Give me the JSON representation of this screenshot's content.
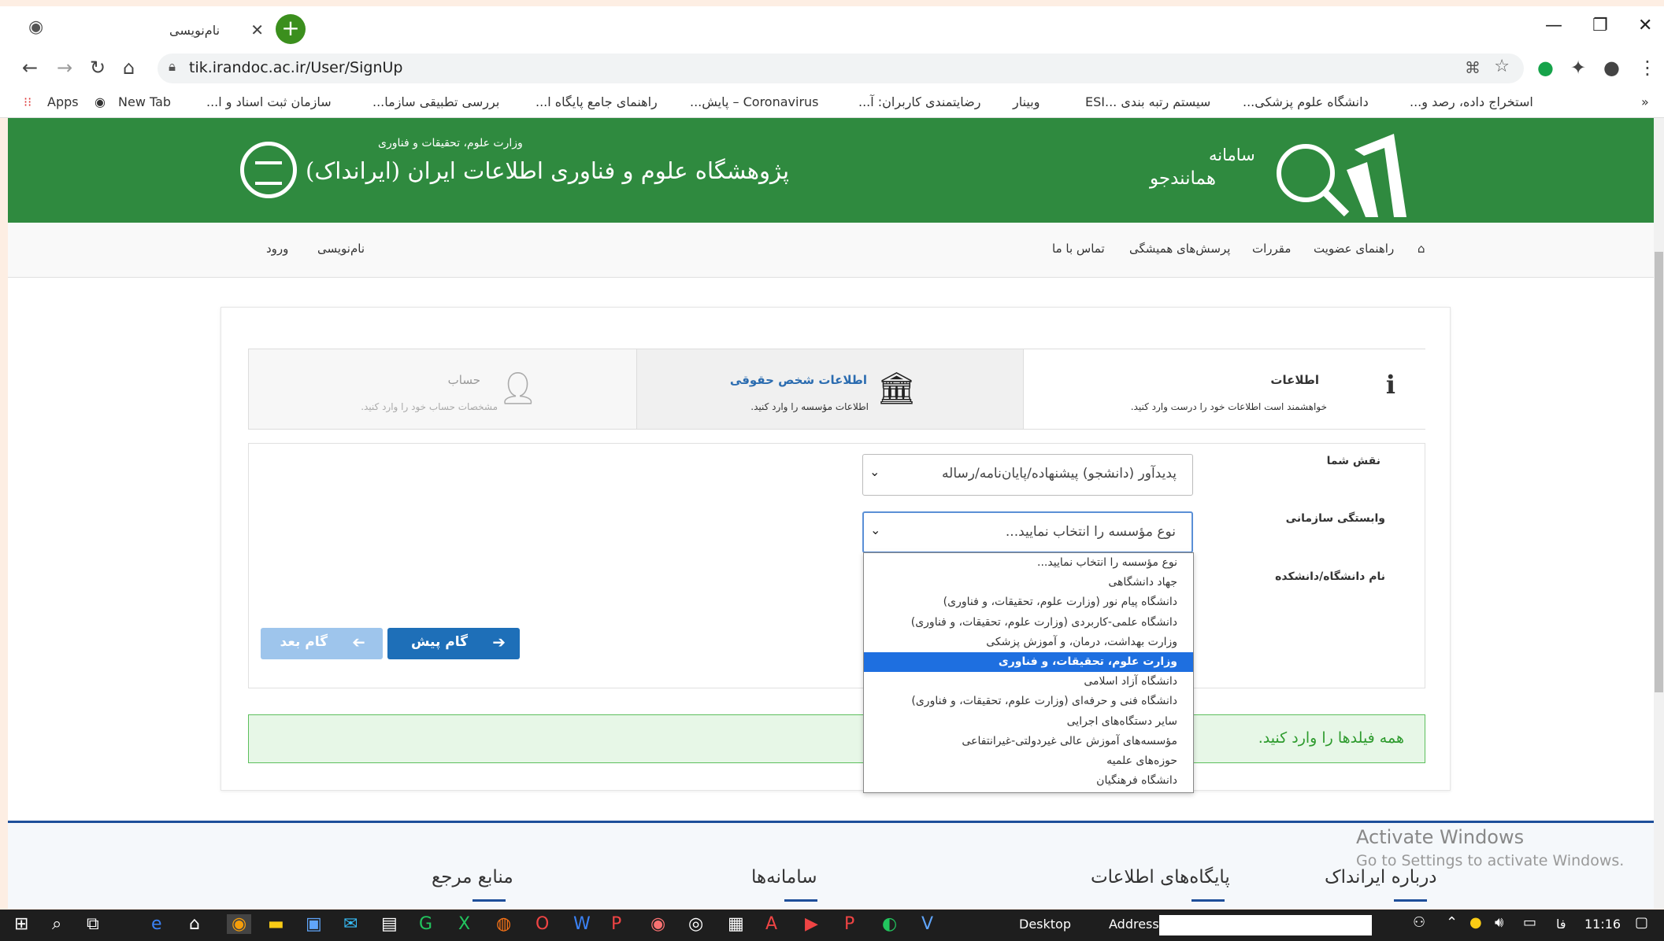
{
  "browser": {
    "tab_title": "نام‌نویسی",
    "url": "tik.irandoc.ac.ir/User/SignUp",
    "bookmarks": [
      "Apps",
      "New Tab",
      "سازمان ثبت اسناد و ا...",
      "بررسی تطبیقی سازما...",
      "راهنمای جامع پایگاه ا...",
      "Coronavirus – پایش...",
      "رضایتمندی کاربران: آ...",
      "وبینار",
      "سیستم رتبه بندی ...ESI",
      "دانشگاه علوم پزشکی...",
      "استخراج داده، رصد و..."
    ]
  },
  "header": {
    "ministry": "وزارت علوم، تحقیقات و فناوری",
    "institute": "پژوهشگاه علوم و فناوری اطلاعات ایران (ایرانداک)",
    "system_line1": "سامانه",
    "system_line2": "همانندجو"
  },
  "menu": {
    "home_icon": "home-icon",
    "items": [
      "راهنمای عضویت",
      "مقررات",
      "پرسش‌های همیشگی",
      "تماس با ما"
    ],
    "signup": "نام‌نویسی",
    "login": "ورود"
  },
  "steps": [
    {
      "title": "اطلاعات",
      "subtitle": "خواهشمند است اطلاعات خود را درست وارد کنید.",
      "icon": "info-icon"
    },
    {
      "title": "اطلاعات شخص حقوقی",
      "subtitle": "اطلاعات مؤسسه را وارد کنید.",
      "icon": "institution-icon"
    },
    {
      "title": "حساب",
      "subtitle": "مشخصات حساب خود را وارد کنید.",
      "icon": "user-icon"
    }
  ],
  "form": {
    "role_label": "نقش شما",
    "role_value": "پدیدآور (دانشجو) پیشنهاده/پایان‌نامه/رساله",
    "affiliation_label": "وابستگی سازمانی",
    "affiliation_value": "نوع مؤسسه را انتخاب نمایید...",
    "university_label": "نام دانشگاه/دانشکده",
    "prev_button": "گام پیش",
    "next_button": "گام بعد"
  },
  "dropdown_options": [
    "نوع مؤسسه را انتخاب نمایید...",
    "جهاد دانشگاهی",
    "دانشگاه پیام نور (وزارت علوم، تحقیقات، و فناوری)",
    "دانشگاه علمی-کاربردی (وزارت علوم، تحقیقات، و فناوری)",
    "وزارت بهداشت، درمان، و آموزش پزشکی",
    "وزارت علوم، تحقیقات، و فناوری",
    "دانشگاه آزاد اسلامی",
    "دانشگاه فنی و حرفه‌ای (وزارت علوم، تحقیقات، و فناوری)",
    "سایر دستگاه‌های اجرایی",
    "مؤسسه‌های آموزش عالی غیردولتی-غیرانتفاعی",
    "حوزه‌های علمیه",
    "دانشگاه فرهنگیان"
  ],
  "dropdown_selected_index": 5,
  "alert": "همه فیلدها را وارد کنید.",
  "footer": [
    "درباره ایرانداک",
    "پایگاه‌های اطلاعات",
    "سامانه‌ها",
    "منابع مرجع"
  ],
  "watermark": {
    "line1": "Activate Windows",
    "line2": "Go to Settings to activate Windows."
  },
  "taskbar": {
    "desktop": "Desktop",
    "address": "Address",
    "lang": "فا",
    "time": "11:16"
  }
}
